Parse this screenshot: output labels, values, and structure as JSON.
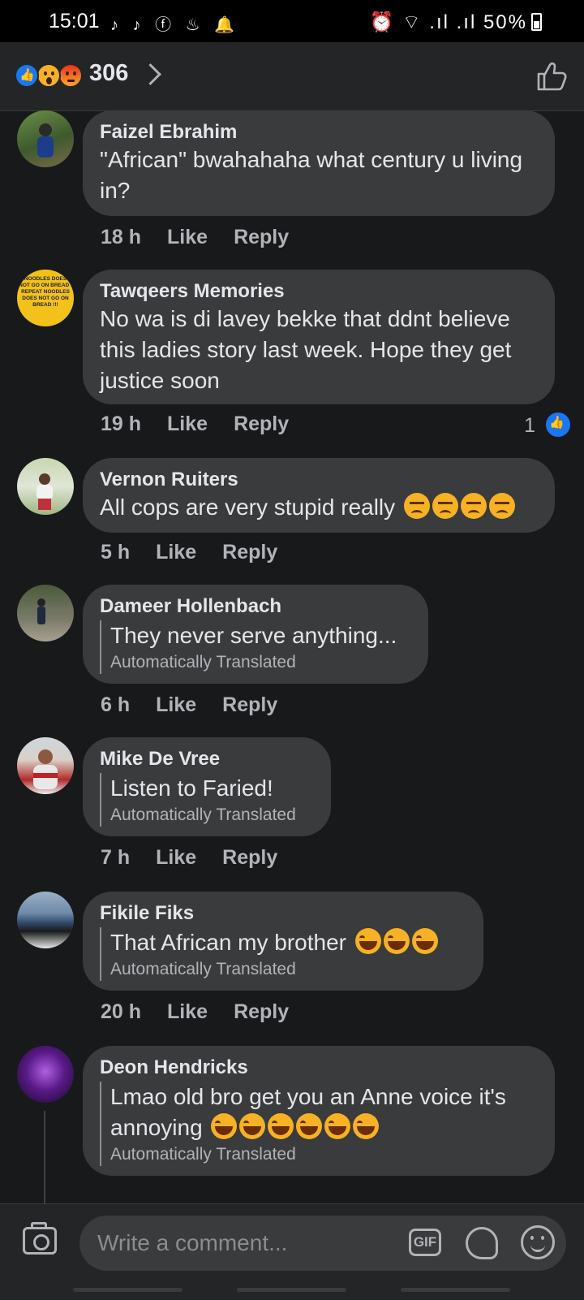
{
  "status_bar": {
    "time": "15:01",
    "left_icons": "♪ ♪ ⓕ ♨ 🔔",
    "right_text": "⏰ ⌔ .ıl .ıl 50%",
    "battery_percent": 50
  },
  "header": {
    "reaction_count": "306",
    "reactions": [
      "like-icon",
      "wow-icon",
      "angry-icon"
    ]
  },
  "comments": [
    {
      "author": "Faizel Ebrahim",
      "text": "\"African\" bwahahaha what century u living in?",
      "time": "18 h",
      "like_label": "Like",
      "reply_label": "Reply"
    },
    {
      "author": "Tawqeers Memories",
      "text": "No wa is di lavey bekke that ddnt believe this ladies story last week. Hope they get justice soon",
      "time": "19 h",
      "like_label": "Like",
      "reply_label": "Reply",
      "likes": "1",
      "avatar_text": "NOODLES DOES NOT GO ON BREAD I REPEAT NOODLES DOES NOT GO ON BREAD !!!"
    },
    {
      "author": "Vernon Ruiters",
      "text": "All cops are very stupid really",
      "time": "5 h",
      "like_label": "Like",
      "reply_label": "Reply",
      "emojis": [
        "angry-face",
        "angry-face",
        "angry-face",
        "steam-face"
      ]
    },
    {
      "author": "Dameer Hollenbach",
      "text": "They never serve anything...",
      "translated_note": "Automatically Translated",
      "time": "6 h",
      "like_label": "Like",
      "reply_label": "Reply"
    },
    {
      "author": "Mike De Vree",
      "text": "Listen to Faried!",
      "translated_note": "Automatically Translated",
      "time": "7 h",
      "like_label": "Like",
      "reply_label": "Reply"
    },
    {
      "author": "Fikile Fiks",
      "text": "That African my brother",
      "translated_note": "Automatically Translated",
      "time": "20 h",
      "like_label": "Like",
      "reply_label": "Reply",
      "emojis": [
        "rofl",
        "rofl",
        "rofl"
      ]
    },
    {
      "author": "Deon Hendricks",
      "text_line1": "Lmao old bro get you an Anne voice it's",
      "text_line2": "annoying",
      "translated_note": "Automatically Translated",
      "emojis": [
        "joy",
        "joy",
        "joy",
        "joy",
        "joy",
        "joy"
      ]
    }
  ],
  "composer": {
    "placeholder": "Write a comment...",
    "gif_label": "GIF"
  }
}
